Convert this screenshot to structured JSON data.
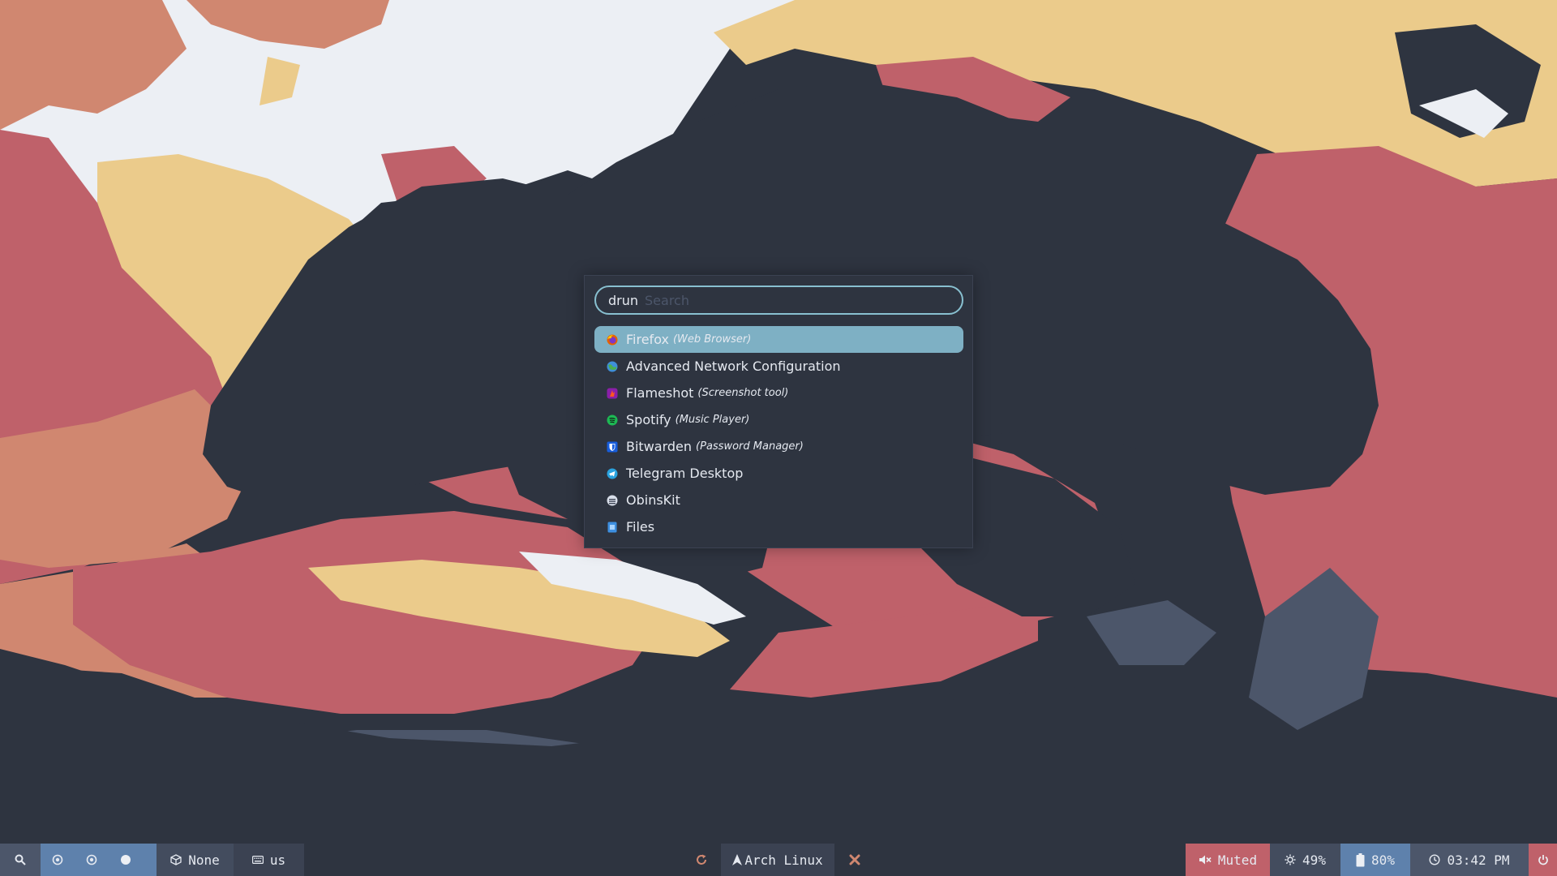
{
  "launcher": {
    "mode": "drun",
    "search_placeholder": "Search",
    "search_value": "",
    "items": [
      {
        "name": "Firefox",
        "desc": "(Web Browser)",
        "icon": "firefox-icon",
        "selected": true
      },
      {
        "name": "Advanced Network Configuration",
        "desc": "",
        "icon": "network-icon",
        "selected": false
      },
      {
        "name": "Flameshot",
        "desc": "(Screenshot tool)",
        "icon": "flameshot-icon",
        "selected": false
      },
      {
        "name": "Spotify",
        "desc": "(Music Player)",
        "icon": "spotify-icon",
        "selected": false
      },
      {
        "name": "Bitwarden",
        "desc": "(Password Manager)",
        "icon": "bitwarden-icon",
        "selected": false
      },
      {
        "name": "Telegram Desktop",
        "desc": "",
        "icon": "telegram-icon",
        "selected": false
      },
      {
        "name": "ObinsKit",
        "desc": "",
        "icon": "obinskit-icon",
        "selected": false
      },
      {
        "name": "Files",
        "desc": "",
        "icon": "files-icon",
        "selected": false
      }
    ]
  },
  "bar": {
    "window_label": "None",
    "keyboard_layout": "us",
    "distro_label": "Arch Linux",
    "volume_label": "Muted",
    "brightness_label": "49%",
    "battery_label": "80%",
    "clock_label": "03:42 PM",
    "icons": {
      "search": "search-icon",
      "workspace": "circle-icon",
      "window": "cube-icon",
      "keyboard": "keyboard-icon",
      "reload": "reload-icon",
      "arch": "arch-logo-icon",
      "close": "close-icon",
      "volume": "mute-icon",
      "brightness": "brightness-icon",
      "battery": "battery-icon",
      "clock": "clock-icon",
      "power": "power-icon"
    }
  },
  "colors": {
    "background": "#2e3440",
    "accent": "#88c0d0",
    "selected": "#7eb0c4",
    "red": "#bf616a",
    "orange": "#d08770",
    "yellow": "#ebcb8b",
    "blue": "#5e81ac",
    "snow": "#eceff4"
  }
}
